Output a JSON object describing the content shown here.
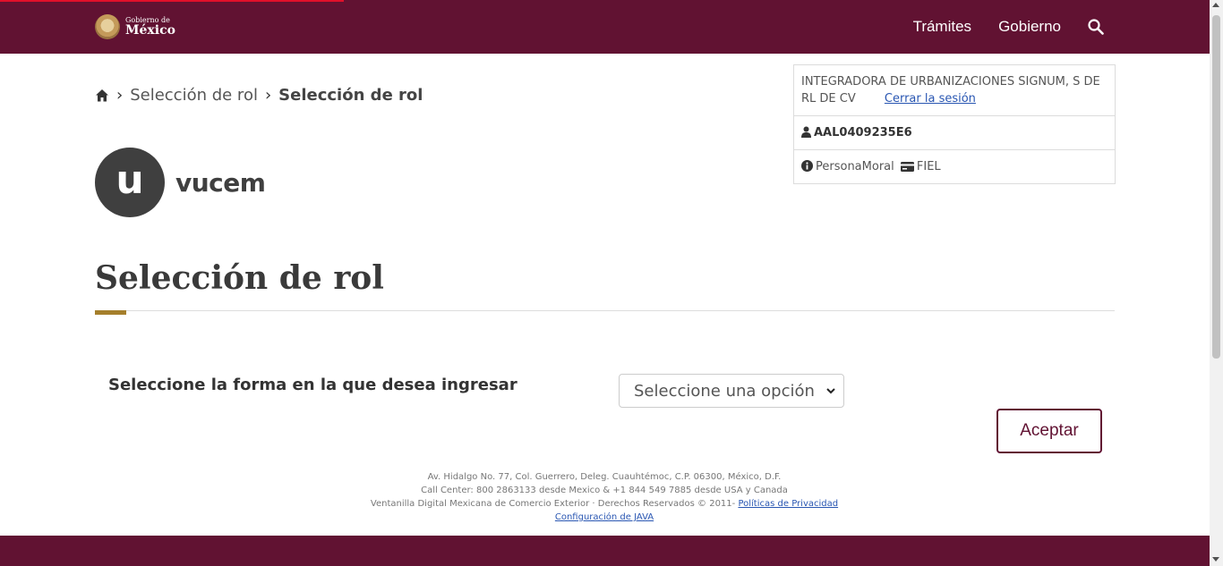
{
  "header": {
    "logo_small": "Gobierno de",
    "logo_big": "México",
    "nav": [
      "Trámites",
      "Gobierno"
    ]
  },
  "breadcrumb": {
    "items": [
      "Selección de rol",
      "Selección de rol"
    ]
  },
  "session": {
    "company": "INTEGRADORA DE URBANIZACIONES SIGNUM, S DE RL DE CV",
    "logout": "Cerrar la sesión",
    "rfc": "AAL0409235E6",
    "person_type": "PersonaMoral",
    "auth_type": "FIEL"
  },
  "brand": {
    "letter": "u",
    "word": "vucem"
  },
  "page": {
    "title": "Selección de rol"
  },
  "form": {
    "label": "Seleccione la forma en la que desea ingresar",
    "select_value": "Seleccione una opción",
    "accept": "Aceptar"
  },
  "footer": {
    "address": "Av. Hidalgo No. 77, Col. Guerrero, Deleg. Cuauhtémoc, C.P. 06300, México, D.F.",
    "call_center": "Call Center: 800 2863133 desde Mexico & +1 844 549 7885 desde USA y Canada",
    "rights": "Ventanilla Digital Mexicana de Comercio Exterior · Derechos Reservados © 2011-",
    "privacy": "Políticas de Privacidad",
    "java": "Configuración de JAVA"
  },
  "colors": {
    "brand": "#611232",
    "accent": "#a57f2c"
  }
}
